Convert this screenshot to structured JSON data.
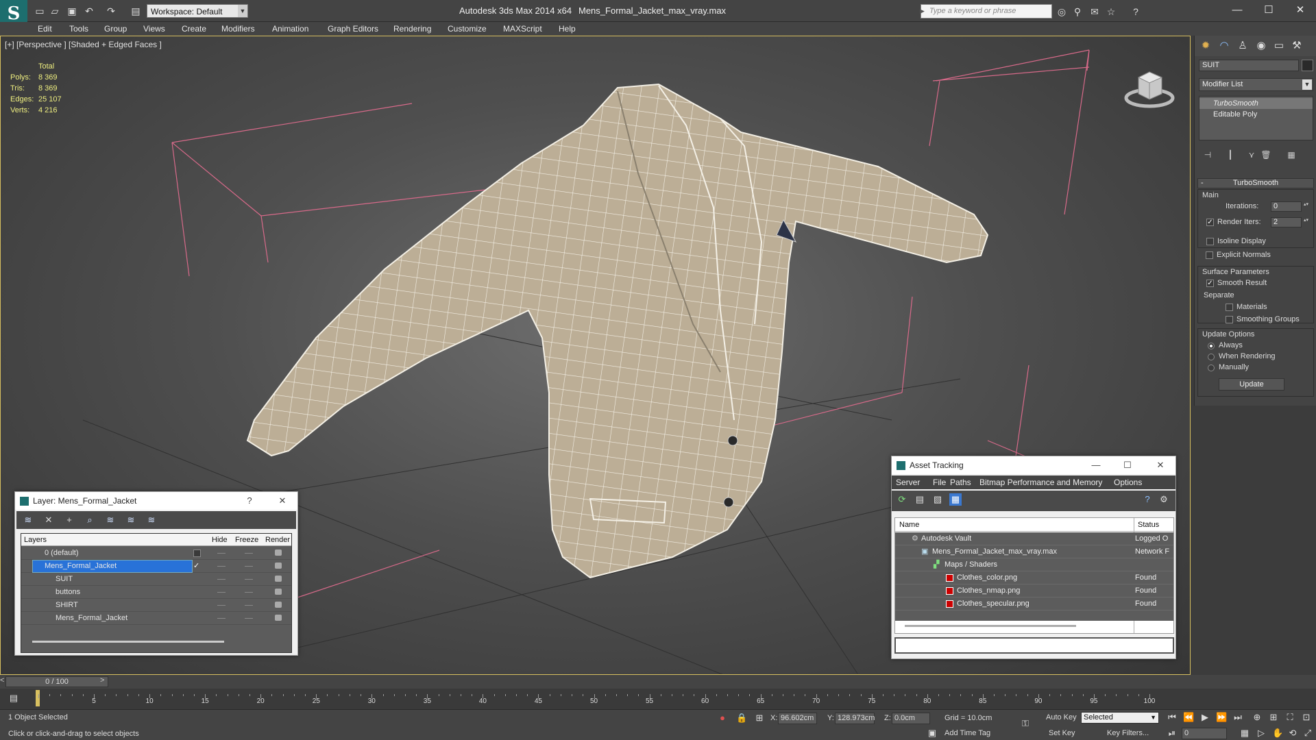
{
  "title": {
    "app": "Autodesk 3ds Max  2014 x64",
    "file": "Mens_Formal_Jacket_max_vray.max",
    "workspace": "Workspace: Default",
    "search_placeholder": "Type a keyword or phrase"
  },
  "menu": [
    "Edit",
    "Tools",
    "Group",
    "Views",
    "Create",
    "Modifiers",
    "Animation",
    "Graph Editors",
    "Rendering",
    "Customize",
    "MAXScript",
    "Help"
  ],
  "viewport": {
    "label": "[+] [Perspective ] [Shaded + Edged Faces ]",
    "stats": {
      "total_label": "Total",
      "rows": [
        {
          "k": "Polys:",
          "v": "8 369"
        },
        {
          "k": "Tris:",
          "v": "8 369"
        },
        {
          "k": "Edges:",
          "v": "25 107"
        },
        {
          "k": "Verts:",
          "v": "4 216"
        }
      ]
    }
  },
  "command_panel": {
    "object_name": "SUIT",
    "modifier_list": "Modifier List",
    "stack": [
      "TurboSmooth",
      "Editable Poly"
    ],
    "rollout_title": "TurboSmooth",
    "main_label": "Main",
    "iterations_label": "Iterations:",
    "iterations_value": "0",
    "render_iters_label": "Render Iters:",
    "render_iters_value": "2",
    "isoline": "Isoline Display",
    "explicit": "Explicit Normals",
    "surface_params": "Surface Parameters",
    "smooth_result": "Smooth Result",
    "separate": "Separate",
    "materials": "Materials",
    "smoothing_groups": "Smoothing Groups",
    "update_options": "Update Options",
    "always": "Always",
    "when_rendering": "When Rendering",
    "manually": "Manually",
    "update_button": "Update"
  },
  "layer_dialog": {
    "title": "Layer: Mens_Formal_Jacket",
    "help": "?",
    "columns": [
      "Layers",
      "Hide",
      "Freeze",
      "Render"
    ],
    "rows": [
      {
        "name": "0 (default)",
        "indent": 0
      },
      {
        "name": "Mens_Formal_Jacket",
        "indent": 0,
        "selected": true
      },
      {
        "name": "SUIT",
        "indent": 1
      },
      {
        "name": "buttons",
        "indent": 1
      },
      {
        "name": "SHIRT",
        "indent": 1
      },
      {
        "name": "Mens_Formal_Jacket",
        "indent": 1
      }
    ]
  },
  "asset_tracking": {
    "title": "Asset Tracking",
    "menu": [
      "Server",
      "File",
      "Paths",
      "Bitmap Performance and Memory",
      "Options"
    ],
    "columns": [
      "Name",
      "Status"
    ],
    "rows": [
      {
        "name": "Autodesk Vault",
        "status": "Logged O",
        "indent": 0
      },
      {
        "name": "Mens_Formal_Jacket_max_vray.max",
        "status": "Network F",
        "indent": 1
      },
      {
        "name": "Maps / Shaders",
        "status": "",
        "indent": 2
      },
      {
        "name": "Clothes_color.png",
        "status": "Found",
        "indent": 3
      },
      {
        "name": "Clothes_nmap.png",
        "status": "Found",
        "indent": 3
      },
      {
        "name": "Clothes_specular.png",
        "status": "Found",
        "indent": 3
      }
    ]
  },
  "timeline": {
    "frame": "0 / 100",
    "ticks": [
      "5",
      "10",
      "15",
      "20",
      "25",
      "30",
      "35",
      "40",
      "45",
      "50",
      "55",
      "60",
      "65",
      "70",
      "75",
      "80",
      "85",
      "90",
      "95",
      "100"
    ]
  },
  "status": {
    "selected": "1 Object Selected",
    "prompt": "Click or click-and-drag to select objects",
    "x_label": "X:",
    "x": "96.602cm",
    "y_label": "Y:",
    "y": "128.973cm",
    "z_label": "Z:",
    "z": "0.0cm",
    "grid": "Grid = 10.0cm",
    "auto_key": "Auto Key",
    "selected_set": "Selected",
    "set_key": "Set Key",
    "key_filters": "Key Filters...",
    "add_time_tag": "Add Time Tag",
    "frame_field": "0"
  }
}
